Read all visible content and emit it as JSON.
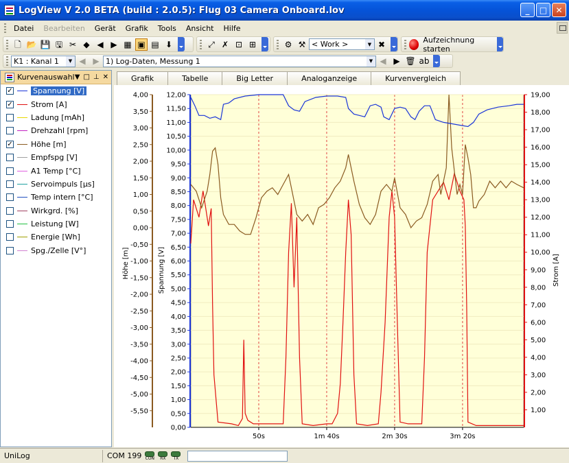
{
  "window": {
    "title": "LogView V 2.0 BETA (build : 2.0.5): Flug 03 Camera Onboard.lov"
  },
  "menu": [
    {
      "label": "Datei",
      "enabled": true
    },
    {
      "label": "Bearbeiten",
      "enabled": false
    },
    {
      "label": "Gerät",
      "enabled": true
    },
    {
      "label": "Grafik",
      "enabled": true
    },
    {
      "label": "Tools",
      "enabled": true
    },
    {
      "label": "Ansicht",
      "enabled": true
    },
    {
      "label": "Hilfe",
      "enabled": true
    }
  ],
  "toolbar": {
    "profile_combo": "< Work >",
    "record_label": "Aufzeichnung starten",
    "channel_combo": "K1 : Kanal 1",
    "dataset_combo": "1) Log-Daten, Messung 1"
  },
  "curve_panel": {
    "title": "Kurvenauswahl",
    "items": [
      {
        "label": "Spannung [V]",
        "checked": true,
        "color": "#1a35d8",
        "selected": true
      },
      {
        "label": "Strom [A]",
        "checked": true,
        "color": "#e01010",
        "selected": false
      },
      {
        "label": "Ladung [mAh]",
        "checked": false,
        "color": "#e8d800",
        "selected": false
      },
      {
        "label": "Drehzahl [rpm]",
        "checked": false,
        "color": "#c020c0",
        "selected": false
      },
      {
        "label": "Höhe [m]",
        "checked": true,
        "color": "#8a5a20",
        "selected": false
      },
      {
        "label": "Empfspg [V]",
        "checked": false,
        "color": "#a0a0a0",
        "selected": false
      },
      {
        "label": "A1 Temp [°C]",
        "checked": false,
        "color": "#e060e0",
        "selected": false
      },
      {
        "label": "Servoimpuls [µs]",
        "checked": false,
        "color": "#20a0a0",
        "selected": false
      },
      {
        "label": "Temp intern [°C]",
        "checked": false,
        "color": "#2050c0",
        "selected": false
      },
      {
        "label": "Wirkgrd. [%]",
        "checked": false,
        "color": "#a04060",
        "selected": false
      },
      {
        "label": "Leistung [W]",
        "checked": false,
        "color": "#20c040",
        "selected": false
      },
      {
        "label": "Energie [Wh]",
        "checked": false,
        "color": "#a0a000",
        "selected": false
      },
      {
        "label": "Spg./Zelle [V°]",
        "checked": false,
        "color": "#d080d0",
        "selected": false
      }
    ]
  },
  "tabs": [
    {
      "label": "Grafik",
      "active": true
    },
    {
      "label": "Tabelle",
      "active": false
    },
    {
      "label": "Big Letter",
      "active": false
    },
    {
      "label": "Analoganzeige",
      "active": false
    },
    {
      "label": "Kurvenvergleich",
      "active": false
    }
  ],
  "chart_data": {
    "type": "line",
    "grid": true,
    "x_ticks": [
      "50s",
      "1m 40s",
      "2m 30s",
      "3m 20s"
    ],
    "x_tick_seconds": [
      50,
      100,
      150,
      200
    ],
    "x_range_seconds": [
      0,
      245
    ],
    "axes": {
      "hoehe": {
        "label": "Höhe [m]",
        "min": -6.0,
        "max": 4.0,
        "ticks": [
          "4,00",
          "3,50",
          "3,00",
          "2,50",
          "2,00",
          "1,50",
          "1,00",
          "0,50",
          "0,00",
          "-0,50",
          "-1,00",
          "-1,50",
          "-2,00",
          "-2,50",
          "-3,00",
          "-3,50",
          "-4,00",
          "-4,50",
          "-5,00",
          "-5,50"
        ]
      },
      "spannung": {
        "label": "Spannung [V]",
        "min": 0.0,
        "max": 12.0,
        "ticks": [
          "12,00",
          "11,50",
          "11,00",
          "10,50",
          "10,00",
          "9,50",
          "9,00",
          "8,50",
          "8,00",
          "7,50",
          "7,00",
          "6,50",
          "6,00",
          "5,50",
          "5,00",
          "4,50",
          "4,00",
          "3,50",
          "3,00",
          "2,50",
          "2,00",
          "1,50",
          "1,00",
          "0,50",
          "0,00"
        ]
      },
      "strom": {
        "label": "Strom [A]",
        "min": 0.0,
        "max": 19.0,
        "ticks": [
          "19,00",
          "18,00",
          "17,00",
          "16,00",
          "15,00",
          "14,00",
          "13,00",
          "12,00",
          "11,00",
          "10,00",
          "9,00",
          "8,00",
          "7,00",
          "6,00",
          "5,00",
          "4,00",
          "3,00",
          "2,00",
          "1,00"
        ]
      }
    },
    "series": [
      {
        "name": "Spannung [V]",
        "axis": "spannung",
        "color": "#1a35d8",
        "points": [
          [
            0,
            11.9
          ],
          [
            3,
            11.6
          ],
          [
            6,
            11.25
          ],
          [
            10,
            11.25
          ],
          [
            14,
            11.15
          ],
          [
            18,
            11.2
          ],
          [
            22,
            11.1
          ],
          [
            24,
            11.65
          ],
          [
            28,
            11.7
          ],
          [
            32,
            11.85
          ],
          [
            40,
            11.95
          ],
          [
            50,
            12.0
          ],
          [
            60,
            12.0
          ],
          [
            68,
            12.0
          ],
          [
            72,
            11.6
          ],
          [
            76,
            11.45
          ],
          [
            80,
            11.4
          ],
          [
            84,
            11.75
          ],
          [
            92,
            11.9
          ],
          [
            100,
            11.95
          ],
          [
            108,
            11.95
          ],
          [
            114,
            11.9
          ],
          [
            116,
            11.5
          ],
          [
            120,
            11.3
          ],
          [
            124,
            11.25
          ],
          [
            128,
            11.2
          ],
          [
            132,
            11.6
          ],
          [
            136,
            11.65
          ],
          [
            140,
            11.55
          ],
          [
            142,
            11.2
          ],
          [
            146,
            11.1
          ],
          [
            150,
            11.5
          ],
          [
            154,
            11.55
          ],
          [
            158,
            11.5
          ],
          [
            162,
            11.2
          ],
          [
            165,
            11.1
          ],
          [
            168,
            11.4
          ],
          [
            172,
            11.6
          ],
          [
            176,
            11.6
          ],
          [
            180,
            11.1
          ],
          [
            186,
            11.0
          ],
          [
            192,
            10.95
          ],
          [
            198,
            10.9
          ],
          [
            204,
            10.85
          ],
          [
            208,
            11.0
          ],
          [
            212,
            11.3
          ],
          [
            218,
            11.45
          ],
          [
            226,
            11.55
          ],
          [
            234,
            11.6
          ],
          [
            240,
            11.65
          ],
          [
            245,
            11.65
          ]
        ]
      },
      {
        "name": "Strom [A]",
        "axis": "strom",
        "color": "#e01010",
        "points": [
          [
            0,
            10.5
          ],
          [
            2,
            13.0
          ],
          [
            6,
            12.0
          ],
          [
            9,
            13.5
          ],
          [
            11,
            12.5
          ],
          [
            13,
            11.5
          ],
          [
            15,
            12.5
          ],
          [
            16,
            7.0
          ],
          [
            17,
            3.0
          ],
          [
            20,
            0.3
          ],
          [
            30,
            0.2
          ],
          [
            35,
            0.1
          ],
          [
            38,
            0.5
          ],
          [
            39,
            5.0
          ],
          [
            40,
            0.8
          ],
          [
            42,
            0.4
          ],
          [
            46,
            0.2
          ],
          [
            60,
            0.2
          ],
          [
            68,
            0.2
          ],
          [
            70,
            4.0
          ],
          [
            72,
            10.0
          ],
          [
            74,
            12.8
          ],
          [
            76,
            8.0
          ],
          [
            78,
            12.0
          ],
          [
            80,
            4.0
          ],
          [
            82,
            0.2
          ],
          [
            90,
            0.1
          ],
          [
            100,
            0.2
          ],
          [
            104,
            0.2
          ],
          [
            108,
            0.8
          ],
          [
            110,
            2.5
          ],
          [
            112,
            6.0
          ],
          [
            114,
            10.0
          ],
          [
            116,
            13.0
          ],
          [
            118,
            11.0
          ],
          [
            120,
            3.0
          ],
          [
            122,
            0.2
          ],
          [
            130,
            0.1
          ],
          [
            138,
            0.2
          ],
          [
            140,
            2.0
          ],
          [
            143,
            6.0
          ],
          [
            146,
            12.0
          ],
          [
            148,
            13.5
          ],
          [
            150,
            12.0
          ],
          [
            152,
            6.0
          ],
          [
            154,
            0.3
          ],
          [
            160,
            0.2
          ],
          [
            170,
            0.2
          ],
          [
            172,
            4.0
          ],
          [
            174,
            10.0
          ],
          [
            178,
            13.0
          ],
          [
            182,
            13.5
          ],
          [
            186,
            14.0
          ],
          [
            190,
            13.0
          ],
          [
            194,
            14.5
          ],
          [
            198,
            13.5
          ],
          [
            201,
            13.0
          ],
          [
            202,
            11.5
          ],
          [
            203,
            7.0
          ],
          [
            204,
            0.3
          ],
          [
            210,
            0.1
          ],
          [
            245,
            0.1
          ]
        ]
      },
      {
        "name": "Höhe [m]",
        "axis": "hoehe",
        "color": "#8a5a20",
        "points": [
          [
            0,
            1.3
          ],
          [
            4,
            1.1
          ],
          [
            8,
            0.6
          ],
          [
            12,
            1.1
          ],
          [
            14,
            1.6
          ],
          [
            16,
            2.3
          ],
          [
            18,
            2.4
          ],
          [
            20,
            1.9
          ],
          [
            22,
            0.9
          ],
          [
            24,
            0.4
          ],
          [
            28,
            0.1
          ],
          [
            32,
            0.1
          ],
          [
            36,
            -0.1
          ],
          [
            40,
            -0.2
          ],
          [
            44,
            -0.2
          ],
          [
            48,
            0.3
          ],
          [
            52,
            0.9
          ],
          [
            56,
            1.1
          ],
          [
            60,
            1.2
          ],
          [
            64,
            1.0
          ],
          [
            68,
            1.3
          ],
          [
            72,
            1.6
          ],
          [
            74,
            1.2
          ],
          [
            78,
            0.4
          ],
          [
            82,
            0.2
          ],
          [
            86,
            0.4
          ],
          [
            90,
            0.1
          ],
          [
            94,
            0.6
          ],
          [
            98,
            0.7
          ],
          [
            102,
            0.9
          ],
          [
            106,
            1.2
          ],
          [
            110,
            1.4
          ],
          [
            114,
            1.8
          ],
          [
            116,
            2.2
          ],
          [
            118,
            1.8
          ],
          [
            120,
            1.4
          ],
          [
            124,
            0.7
          ],
          [
            128,
            0.3
          ],
          [
            132,
            0.1
          ],
          [
            136,
            0.4
          ],
          [
            140,
            1.1
          ],
          [
            144,
            1.3
          ],
          [
            148,
            1.1
          ],
          [
            150,
            1.5
          ],
          [
            154,
            0.6
          ],
          [
            158,
            0.4
          ],
          [
            162,
            0.0
          ],
          [
            166,
            0.2
          ],
          [
            170,
            0.3
          ],
          [
            174,
            0.7
          ],
          [
            178,
            1.4
          ],
          [
            182,
            1.6
          ],
          [
            184,
            1.0
          ],
          [
            188,
            1.8
          ],
          [
            190,
            4.0
          ],
          [
            192,
            2.4
          ],
          [
            194,
            1.7
          ],
          [
            196,
            1.0
          ],
          [
            198,
            1.3
          ],
          [
            200,
            1.0
          ],
          [
            202,
            2.5
          ],
          [
            204,
            2.1
          ],
          [
            206,
            1.6
          ],
          [
            208,
            0.6
          ],
          [
            210,
            0.6
          ],
          [
            212,
            0.8
          ],
          [
            216,
            1.0
          ],
          [
            220,
            1.4
          ],
          [
            224,
            1.2
          ],
          [
            228,
            1.4
          ],
          [
            232,
            1.2
          ],
          [
            236,
            1.4
          ],
          [
            240,
            1.3
          ],
          [
            245,
            1.2
          ]
        ]
      }
    ]
  },
  "status": {
    "app": "UniLog",
    "port": "COM 199",
    "leds": [
      "CON",
      "RX",
      "TX"
    ]
  }
}
